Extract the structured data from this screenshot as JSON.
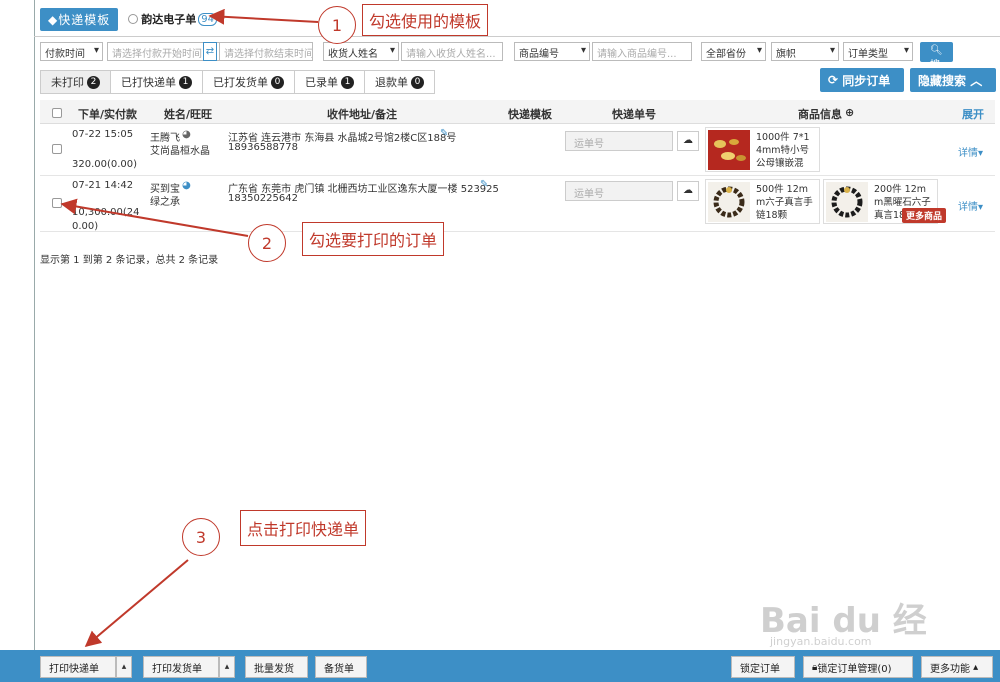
{
  "template_bar": {
    "button": "快递模板",
    "template_name": "韵达电子单",
    "template_count": "94"
  },
  "filters": {
    "pay_time": "付款时间",
    "pay_start_ph": "请选择付款开始时间",
    "swap": "⇄",
    "pay_end_ph": "请选择付款结束时间",
    "receiver": "收货人姓名",
    "receiver_ph": "请输入收货人姓名...",
    "product_code": "商品编号",
    "product_ph": "请输入商品编号...",
    "province": "全部省份",
    "flag": "旗帜",
    "order_type": "订单类型",
    "search": "搜索"
  },
  "tabs": [
    {
      "label": "未打印",
      "count": "2"
    },
    {
      "label": "已打快递单",
      "count": "1"
    },
    {
      "label": "已打发货单",
      "count": "0"
    },
    {
      "label": "已录单",
      "count": "1"
    },
    {
      "label": "退款单",
      "count": "0"
    }
  ],
  "actions": {
    "sync": "同步订单",
    "hide_search": "隐藏搜索"
  },
  "table": {
    "headers": [
      "下单/实付款",
      "姓名/旺旺",
      "收件地址/备注",
      "快递模板",
      "快递单号",
      "商品信息",
      "展开"
    ],
    "rows": [
      {
        "time": "07-22 15:05",
        "amount": "320.00(0.00)",
        "name": "王腾飞",
        "wangwang": "艾尚晶桓水晶",
        "address": "江苏省 连云港市 东海县  水晶城2号馆2楼C区188号",
        "phone": "18936588778",
        "waybill_ph": "运单号",
        "products": [
          {
            "text": "1000件 7*1 4mm特小号 公母镶嵌混"
          }
        ],
        "detail": "详情"
      },
      {
        "time": "07-21 14:42",
        "amount": "10,300.00(240.00)",
        "name": "买到宝",
        "wangwang": "绿之承",
        "address": "广东省 东莞市  虎门镇 北栅西坊工业区逸东大厦一楼 523925",
        "phone": "18350225642",
        "waybill_ph": "运单号",
        "products": [
          {
            "text": "500件 12m m六子真言手链18颗"
          },
          {
            "text": "200件 12m m黑曜石六子真言18"
          }
        ],
        "more": "更多商品",
        "detail": "详情"
      }
    ]
  },
  "summary": "显示第 1 到第 2 条记录，总共 2 条记录",
  "bottom": {
    "print_express": "打印快递单",
    "print_delivery": "打印发货单",
    "batch_ship": "批量发货",
    "prepare": "备货单",
    "lock_order": "锁定订单",
    "lock_manage": "锁定订单管理(0)",
    "more": "更多功能"
  },
  "annotations": {
    "step1_num": "1",
    "step1_text": "勾选使用的模板",
    "step2_num": "2",
    "step2_text": "勾选要打印的订单",
    "step3_num": "3",
    "step3_text": "点击打印快递单"
  },
  "watermark": {
    "logo": "Bai du 经验",
    "url": "jingyan.baidu.com"
  },
  "colors": {
    "accent": "#3d8fc6",
    "annotation": "#c0392b",
    "more_badge": "#c0392b"
  }
}
